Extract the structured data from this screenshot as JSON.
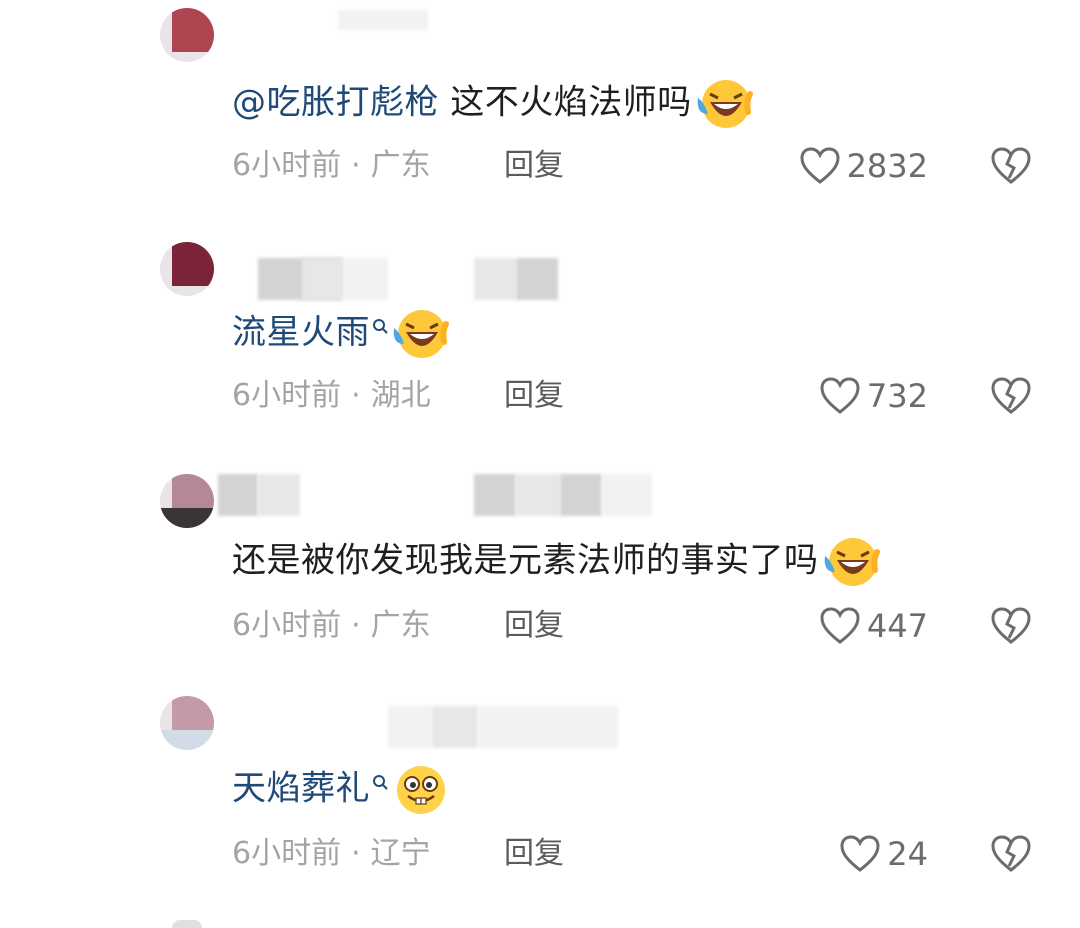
{
  "comments": [
    {
      "mention": "@吃胀打彪枪",
      "text": " 这不火焰法师吗",
      "tag": "",
      "emoji": "laugh-cry-emoji",
      "time": "6小时前",
      "location": "广东",
      "reply": "回复",
      "likes": "2832",
      "avatar_color": "#b04552"
    },
    {
      "mention": "",
      "text": "",
      "tag": "流星火雨",
      "emoji": "laugh-cry-emoji",
      "time": "6小时前",
      "location": "湖北",
      "reply": "回复",
      "likes": "732",
      "avatar_color": "#7a2339"
    },
    {
      "mention": "",
      "text": "还是被你发现我是元素法师的事实了吗",
      "tag": "",
      "emoji": "laugh-cry-emoji",
      "time": "6小时前",
      "location": "广东",
      "reply": "回复",
      "likes": "447",
      "avatar_color": "#b48896"
    },
    {
      "mention": "",
      "text": "",
      "tag": "天焰葬礼",
      "emoji": "buck-teeth-smile-emoji",
      "time": "6小时前",
      "location": "辽宁",
      "reply": "回复",
      "likes": "24",
      "avatar_color": "#c59aa8"
    }
  ],
  "colors": {
    "tag_blue": "#1f4a78",
    "meta_gray": "#a4a4a4",
    "icon_gray": "#6c6c6c"
  }
}
